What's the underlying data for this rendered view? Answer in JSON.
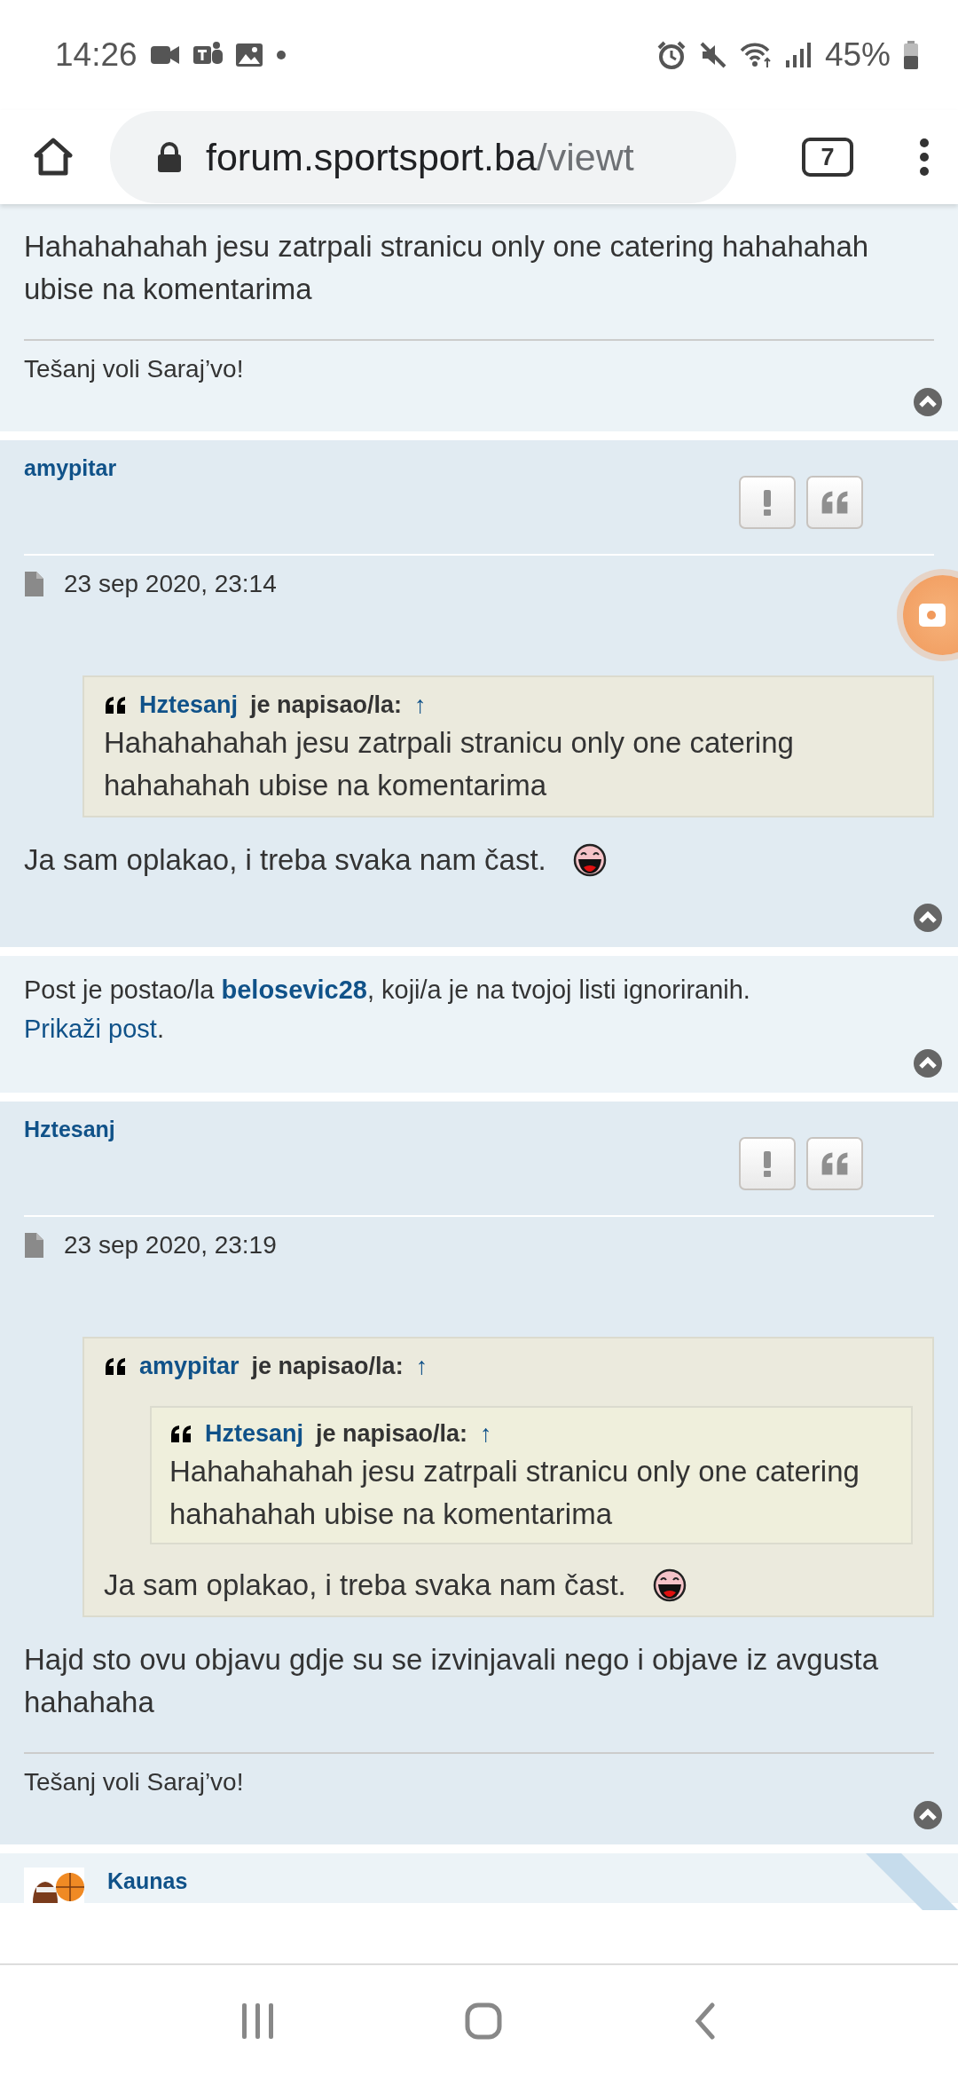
{
  "status_bar": {
    "time": "14:26",
    "battery": "45%"
  },
  "browser": {
    "url_host": "forum.sportsport.ba",
    "url_path": "/viewt",
    "tab_count": "7"
  },
  "posts": [
    {
      "kind": "partial",
      "body": [
        {
          "kind": "paragraph",
          "parts": [
            {
              "kind": "text",
              "text": "Hahahahahah jesu zatrpali stranicu only one catering hahahahah ubise na komentarima"
            }
          ]
        }
      ],
      "signature": "Tešanj voli Saraj’vo!"
    },
    {
      "kind": "post",
      "author": "amypitar",
      "date": "23 sep 2020, 23:14",
      "body": [
        {
          "kind": "quote",
          "author": "Hztesanj",
          "label": "je napisao/la:",
          "arrow": "↑",
          "body": [
            {
              "kind": "paragraph",
              "parts": [
                {
                  "kind": "text",
                  "text": "Hahahahahah jesu zatrpali stranicu only one catering hahahahah ubise na komentarima"
                }
              ]
            }
          ]
        },
        {
          "kind": "paragraph",
          "parts": [
            {
              "kind": "text",
              "text": "Ja sam oplakao, i treba svaka nam čast."
            },
            {
              "kind": "smiley"
            }
          ]
        }
      ]
    },
    {
      "kind": "ignored",
      "before": "Post je postao/la ",
      "user": "belosevic28",
      "after": ", koji/a je na tvojoj listi ignoriranih.",
      "show_link": "Prikaži post",
      "show_after": "."
    },
    {
      "kind": "post",
      "author": "Hztesanj",
      "date": "23 sep 2020, 23:19",
      "body": [
        {
          "kind": "quote",
          "author": "amypitar",
          "label": "je napisao/la:",
          "arrow": "↑",
          "body": [
            {
              "kind": "quote",
              "author": "Hztesanj",
              "label": "je napisao/la:",
              "arrow": "↑",
              "body": [
                {
                  "kind": "paragraph",
                  "parts": [
                    {
                      "kind": "text",
                      "text": "Hahahahahah jesu zatrpali stranicu only one catering hahahahah ubise na komentarima"
                    }
                  ]
                }
              ]
            },
            {
              "kind": "paragraph",
              "parts": [
                {
                  "kind": "text",
                  "text": "Ja sam oplakao, i treba svaka nam čast."
                },
                {
                  "kind": "smiley"
                }
              ]
            }
          ]
        },
        {
          "kind": "paragraph",
          "parts": [
            {
              "kind": "text",
              "text": "Hajd sto ovu objavu gdje su se izvinjavali nego i objave iz avgusta hahahaha"
            }
          ]
        }
      ],
      "signature": "Tešanj voli Saraj’vo!"
    },
    {
      "kind": "avatar_post",
      "author": "Kaunas"
    }
  ]
}
